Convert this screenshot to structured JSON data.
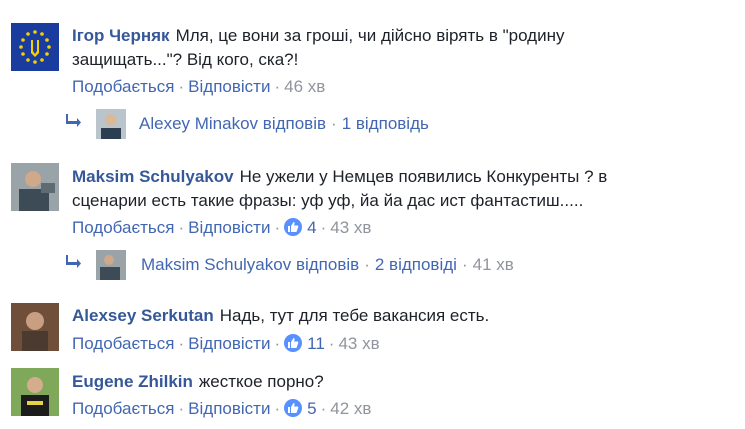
{
  "colors": {
    "link": "#4267b2",
    "author": "#365899",
    "muted": "#90949c",
    "like": "#5890ff"
  },
  "comments": [
    {
      "author": "Ігор Черняк",
      "text": "Мля, це вони за гроші, чи дійсно вірять в \"родину защищать...\"? Від кого, ска?!",
      "like_label": "Подобається",
      "reply_label": "Відповісти",
      "time": "46 хв",
      "reply_summary": {
        "name": "Alexey Minakov",
        "action": "відповів",
        "count": "1 відповідь"
      }
    },
    {
      "author": "Maksim Schulyakov",
      "text": "Не ужели у Немцев появились Конкуренты ? в сценарии есть такие фразы: уф уф, йа йа дас ист фантастиш.....",
      "like_label": "Подобається",
      "reply_label": "Відповісти",
      "likes": "4",
      "time": "43 хв",
      "reply_summary": {
        "name": "Maksim Schulyakov",
        "action": "відповів",
        "count": "2 відповіді",
        "time": "41 хв"
      }
    },
    {
      "author": "Alexsey Serkutan",
      "text": "Надь, тут для тебе вакансия есть.",
      "like_label": "Подобається",
      "reply_label": "Відповісти",
      "likes": "11",
      "time": "43 хв"
    },
    {
      "author": "Eugene Zhilkin",
      "text": "жесткое порно?",
      "like_label": "Подобається",
      "reply_label": "Відповісти",
      "likes": "5",
      "time": "42 хв"
    }
  ],
  "separator": "·",
  "icons": [
    "eu-ukraine-flag-avatar",
    "user-photo-avatar",
    "reply-arrow-icon",
    "like-thumb-icon"
  ]
}
